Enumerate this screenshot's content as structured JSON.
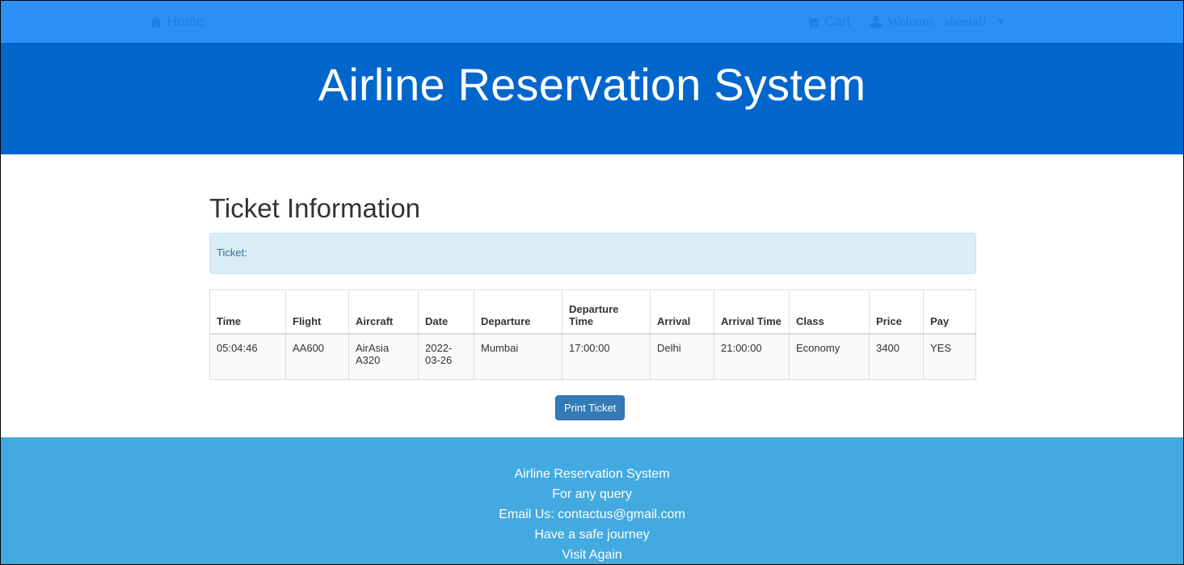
{
  "nav": {
    "home_label": "Home",
    "cart_label": "Cart",
    "welcome_label": "Welcom",
    "username": "sheetal!"
  },
  "banner": {
    "title": "Airline Reservation System"
  },
  "main": {
    "heading": "Ticket Information",
    "alert_text": "Ticket:",
    "table": {
      "headers": [
        "Time",
        "Flight",
        "Aircraft",
        "Date",
        "Departure",
        "Departure Time",
        "Arrival",
        "Arrival Time",
        "Class",
        "Price",
        "Pay"
      ],
      "row": [
        "05:04:46",
        "AA600",
        "AirAsia A320",
        "2022-03-26",
        "Mumbai",
        "17:00:00",
        "Delhi",
        "21:00:00",
        "Economy",
        "3400",
        "YES"
      ]
    },
    "print_button": "Print Ticket"
  },
  "footer": {
    "line1": "Airline Reservation System",
    "line2": "For any query",
    "line3": "Email Us: contactus@gmail.com",
    "line4": "Have a safe journey",
    "line5": "Visit Again"
  },
  "colors": {
    "navbar": "#2a8ff7",
    "banner": "#0066cc",
    "footer": "#42aae0",
    "button": "#337ab7",
    "alert": "#d9edf7"
  }
}
